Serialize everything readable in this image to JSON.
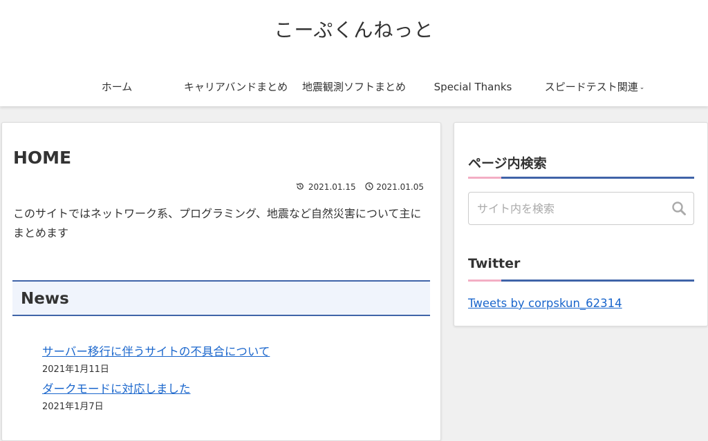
{
  "site": {
    "title": "こーぷくんねっと"
  },
  "nav": [
    {
      "label": "ホーム"
    },
    {
      "label": "キャリアバンドまとめ"
    },
    {
      "label": "地震観測ソフトまとめ"
    },
    {
      "label": "Special Thanks"
    },
    {
      "label": "スピードテスト関連",
      "has_dropdown": true,
      "chevron": "⌄"
    }
  ],
  "main": {
    "title": "HOME",
    "updated_date": "2021.01.15",
    "published_date": "2021.01.05",
    "updated_icon": "history-icon",
    "published_icon": "clock-icon",
    "lead": "このサイトではネットワーク系、プログラミング、地震など自然災害について主にまとめます",
    "news_heading": "News",
    "news": [
      {
        "title": "サーバー移行に伴うサイトの不具合について",
        "date": "2021年1月11日"
      },
      {
        "title": "ダークモードに対応しました",
        "date": "2021年1月7日"
      }
    ]
  },
  "sidebar": {
    "search_title": "ページ内検索",
    "search_placeholder": "サイト内を検索",
    "search_icon": "search-icon",
    "twitter_title": "Twitter",
    "twitter_link": "Tweets by corpskun_62314"
  },
  "colors": {
    "accent_blue": "#3f63a8",
    "accent_pink": "#f3aec4",
    "link": "#1a66cc",
    "news_bg": "#f0f4fc",
    "page_bg": "#f0f0f0"
  }
}
